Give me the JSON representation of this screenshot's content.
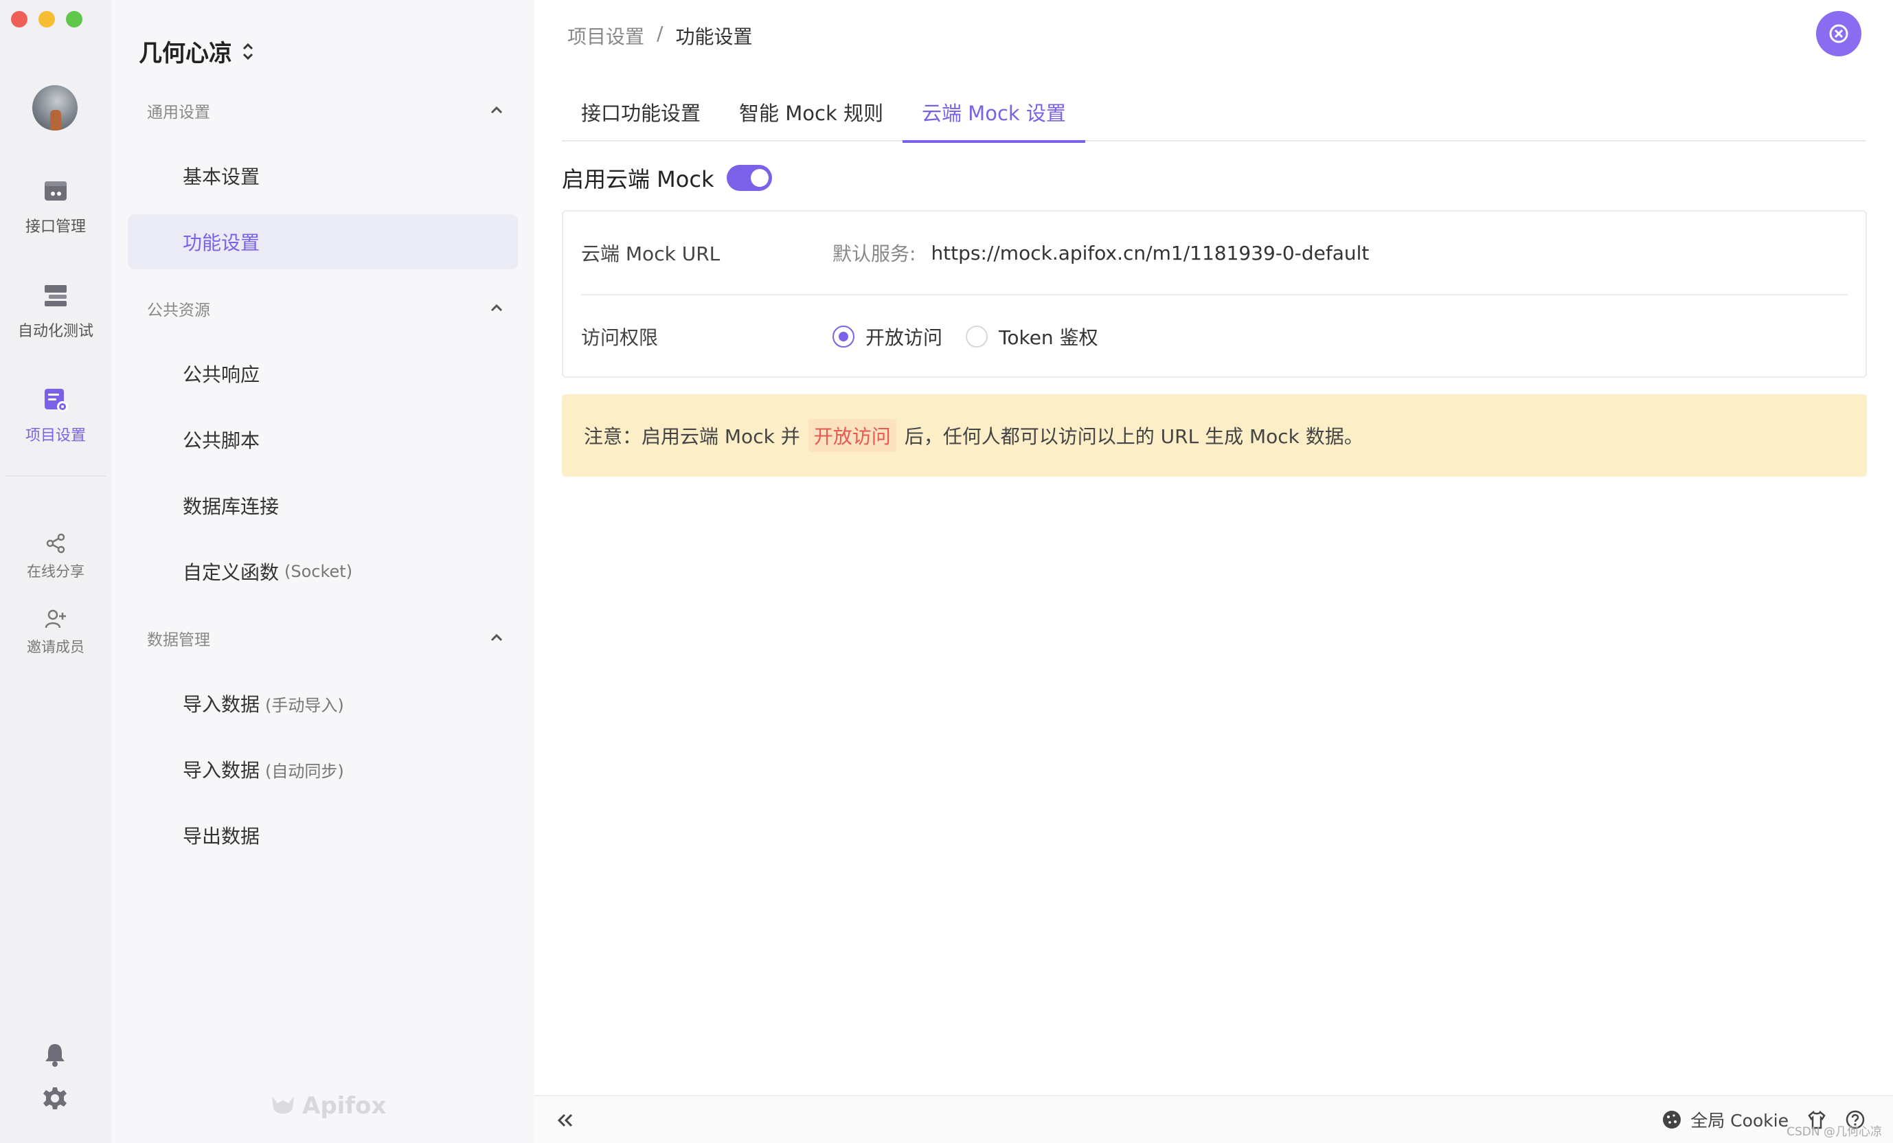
{
  "window": {
    "traffic_lights": [
      "close",
      "minimize",
      "maximize"
    ]
  },
  "rail": {
    "items": [
      {
        "label": "接口管理",
        "icon": "api-icon"
      },
      {
        "label": "自动化测试",
        "icon": "test-icon"
      },
      {
        "label": "项目设置",
        "icon": "project-settings-icon",
        "active": true
      }
    ],
    "secondary": [
      {
        "label": "在线分享",
        "icon": "share-icon"
      },
      {
        "label": "邀请成员",
        "icon": "invite-icon"
      }
    ],
    "bottom_icons": [
      "bell-icon",
      "gear-icon"
    ]
  },
  "sidebar": {
    "project_title": "几何心凉",
    "groups": [
      {
        "header": "通用设置",
        "items": [
          {
            "label": "基本设置",
            "sub": ""
          },
          {
            "label": "功能设置",
            "sub": "",
            "active": true
          }
        ]
      },
      {
        "header": "公共资源",
        "items": [
          {
            "label": "公共响应",
            "sub": ""
          },
          {
            "label": "公共脚本",
            "sub": ""
          },
          {
            "label": "数据库连接",
            "sub": ""
          },
          {
            "label": "自定义函数",
            "sub": "(Socket)"
          }
        ]
      },
      {
        "header": "数据管理",
        "items": [
          {
            "label": "导入数据",
            "sub": "(手动导入)"
          },
          {
            "label": "导入数据",
            "sub": "(自动同步)"
          },
          {
            "label": "导出数据",
            "sub": ""
          }
        ]
      }
    ],
    "brand": "Apifox"
  },
  "header": {
    "breadcrumb": [
      "项目设置",
      "/",
      "功能设置"
    ]
  },
  "tabs": [
    {
      "label": "接口功能设置"
    },
    {
      "label": "智能 Mock 规则"
    },
    {
      "label": "云端 Mock 设置",
      "active": true
    }
  ],
  "cloud_mock": {
    "enable_label": "启用云端 Mock",
    "enabled": true,
    "url_label": "云端 Mock URL",
    "url_prefix": "默认服务:",
    "url": "https://mock.apifox.cn/m1/1181939-0-default",
    "access_label": "访问权限",
    "access_options": [
      {
        "label": "开放访问",
        "checked": true
      },
      {
        "label": "Token 鉴权",
        "checked": false
      }
    ],
    "notice_before": "注意：启用云端 Mock 并",
    "notice_highlight": "开放访问",
    "notice_after": "后，任何人都可以访问以上的 URL 生成 Mock 数据。"
  },
  "footer": {
    "cookie_label": "全局 Cookie",
    "watermark": "CSDN @几何心凉"
  },
  "colors": {
    "accent": "#7b61e8",
    "notice_bg": "#fcefc8",
    "highlight_text": "#e7584f"
  }
}
